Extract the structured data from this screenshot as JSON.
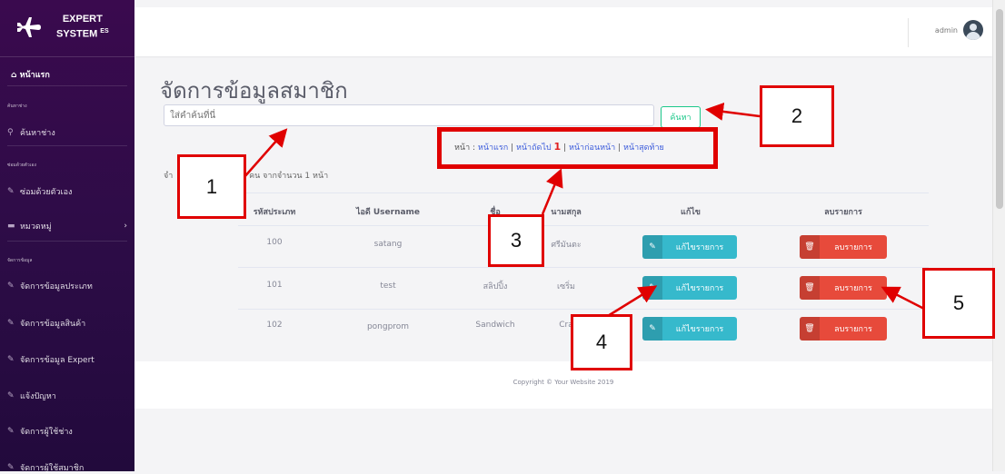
{
  "brand": {
    "line1": "EXPERT",
    "line2": "SYSTEM",
    "sup": "ES"
  },
  "sidebar": {
    "home": "หน้าแรก",
    "section1": "ค้นหาช่าง",
    "search_tech": "ค้นหาช่าง",
    "section2": "ซ่อมด้วยตัวเอง",
    "self_repair": "ซ่อมด้วยตัวเอง",
    "categories": "หมวดหมู่",
    "section3": "จัดการข้อมูล",
    "items": [
      "จัดการข้อมูลประเภท",
      "จัดการข้อมูลสินค้า",
      "จัดการข้อมูล Expert",
      "แจ้งปัญหา",
      "จัดการผู้ใช้ช่าง",
      "จัดการผู้ใช้สมาชิก"
    ]
  },
  "topbar": {
    "username": "admin"
  },
  "main": {
    "title": "จัดการข้อมูลสมาชิก",
    "search_placeholder": "ใส่คำค้นที่นี่",
    "search_button": "ค้นหา",
    "pager": {
      "prefix": "หน้า :",
      "first": "หน้าแรก",
      "next": "หน้าถัดไป",
      "current": "1",
      "prev": "หน้าก่อนหน้า",
      "last": "หน้าสุดท้าย",
      "sep": "|"
    },
    "summary_prefix": "จำ",
    "summary_suffix": "คน จากจำนวน 1 หน้า"
  },
  "table": {
    "headers": [
      "รหัสประเภท",
      "ไอดี Username",
      "ชื่อ",
      "นามสกุล",
      "แก้ไข",
      "ลบรายการ"
    ],
    "rows": [
      {
        "id": "100",
        "username": "satang",
        "name": "ภง",
        "surname": "ศรีมันตะ"
      },
      {
        "id": "101",
        "username": "test",
        "name": "สลิปปิ้ง",
        "surname": "เซริ่ม"
      },
      {
        "id": "102",
        "username": "pongprom",
        "name": "Sandwich",
        "surname": "Cra"
      }
    ],
    "edit_label": "แก้ไขรายการ",
    "delete_label": "ลบรายการ"
  },
  "footer": {
    "copyright": "Copyright © Your Website 2019"
  },
  "callouts": [
    "1",
    "2",
    "3",
    "4",
    "5"
  ],
  "colors": {
    "sidebar": "#2c0c46",
    "edit": "#36b9cc",
    "delete": "#e74a3b",
    "search": "#1cc88a",
    "annotation": "#e00000"
  }
}
